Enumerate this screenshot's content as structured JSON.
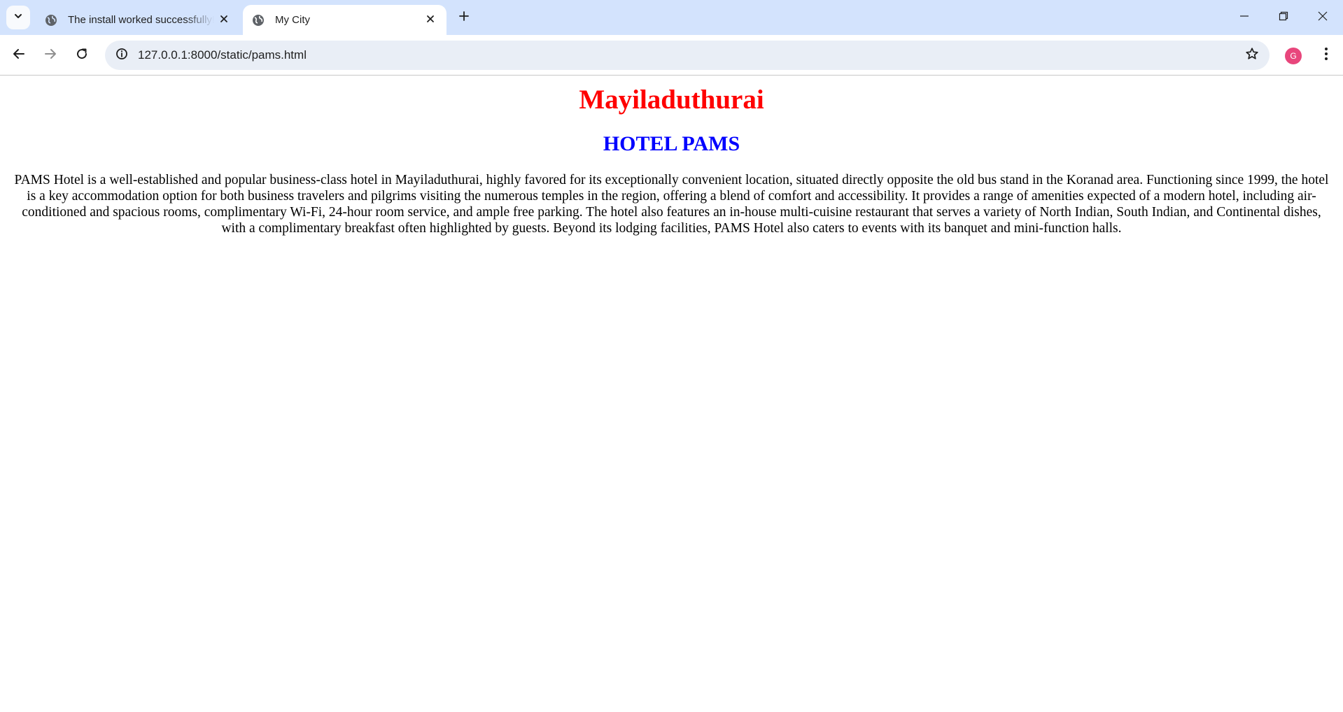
{
  "browser": {
    "tabs": [
      {
        "title": "The install worked successfully! Congratulations!",
        "active": false
      },
      {
        "title": "My City",
        "active": true
      }
    ],
    "address_bar": {
      "url": "127.0.0.1:8000/static/pams.html"
    },
    "profile": {
      "initial": "G",
      "color": "#e8467c"
    },
    "icons": {
      "tab_search": "chevron-down-icon",
      "favicon": "globe-icon",
      "tab_close": "close-icon",
      "new_tab": "plus-icon",
      "back": "arrow-left-icon",
      "forward": "arrow-right-icon",
      "reload": "reload-icon",
      "site_info": "info-icon",
      "bookmark": "star-icon",
      "menu": "kebab-menu-icon",
      "minimize": "minimize-icon",
      "maximize": "restore-icon",
      "close_window": "close-icon"
    }
  },
  "page": {
    "heading": "Mayiladuthurai",
    "subheading": "HOTEL PAMS",
    "paragraph": "PAMS Hotel is a well-established and popular business-class hotel in Mayiladuthurai, highly favored for its exceptionally convenient location, situated directly opposite the old bus stand in the Koranad area. Functioning since 1999, the hotel is a key accommodation option for both business travelers and pilgrims visiting the numerous temples in the region, offering a blend of comfort and accessibility. It provides a range of amenities expected of a modern hotel, including air-conditioned and spacious rooms, complimentary Wi-Fi, 24-hour room service, and ample free parking. The hotel also features an in-house multi-cuisine restaurant that serves a variety of North Indian, South Indian, and Continental dishes, with a complimentary breakfast often highlighted by guests. Beyond its lodging facilities, PAMS Hotel also caters to events with its banquet and mini-function halls.",
    "colors": {
      "heading": "#ff0000",
      "subheading": "#0000ff",
      "text": "#000000"
    }
  }
}
